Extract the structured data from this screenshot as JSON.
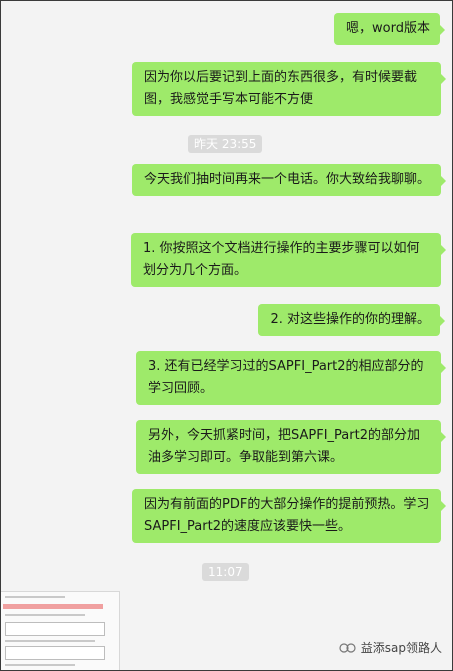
{
  "messages": [
    {
      "text": "嗯，word版本"
    },
    {
      "text": "因为你以后要记到上面的东西很多，有时候要截图，我感觉手写本可能不方便"
    },
    {
      "text": "今天我们抽时间再来一个电话。你大致给我聊聊。"
    },
    {
      "text": "1. 你按照这个文档进行操作的主要步骤可以如何划分为几个方面。"
    },
    {
      "text": "2. 对这些操作的你的理解。"
    },
    {
      "text": "3. 还有已经学习过的SAPFI_Part2的相应部分的学习回顾。"
    },
    {
      "text": "另外，今天抓紧时间，把SAPFI_Part2的部分加油多学习即可。争取能到第六课。"
    },
    {
      "text": "因为有前面的PDF的大部分操作的提前预热。学习SAPFI_Part2的速度应该要快一些。"
    }
  ],
  "timestamps": {
    "first": "昨天 23:55",
    "second": "11:07"
  },
  "watermark": {
    "text": "益添sap领路人",
    "icon": "wechat-official-account-icon"
  },
  "colors": {
    "bubble": "#9eea6a",
    "background": "#f3f3f3",
    "timestamp_bg": "#dadada"
  }
}
